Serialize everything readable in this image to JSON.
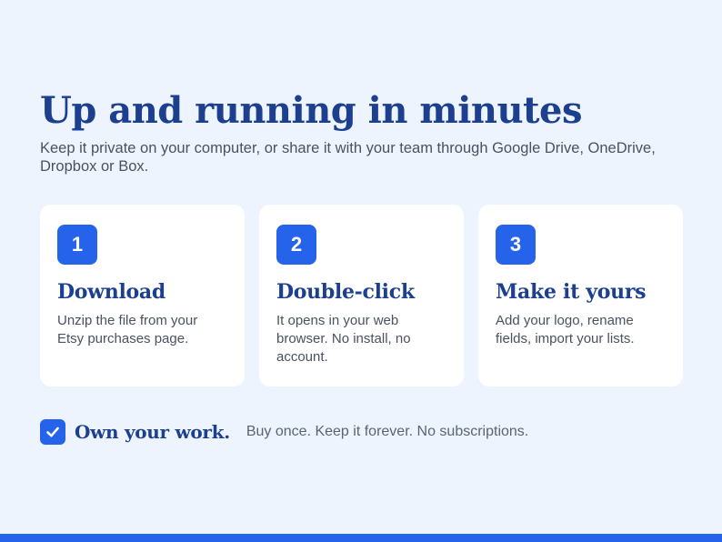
{
  "colors": {
    "background": "#eef4fd",
    "accent": "#2563eb",
    "heading": "#1c3f8f",
    "body_text": "#4a5160",
    "card": "#ffffff"
  },
  "hero": {
    "title": "Up and running in minutes",
    "subtitle": "Keep it private on your computer, or share it with your team through Google Drive, OneDrive, Dropbox or Box."
  },
  "steps": [
    {
      "number": "1",
      "title": "Download",
      "description": "Unzip the file from your Etsy purchases page."
    },
    {
      "number": "2",
      "title": "Double-click",
      "description": "It opens in your web browser. No install, no account."
    },
    {
      "number": "3",
      "title": "Make it yours",
      "description": "Add your logo, rename fields, import your lists."
    }
  ],
  "tagline": {
    "icon": "check-icon",
    "title": "Own your work.",
    "text": "Buy once. Keep it forever. No subscriptions."
  }
}
